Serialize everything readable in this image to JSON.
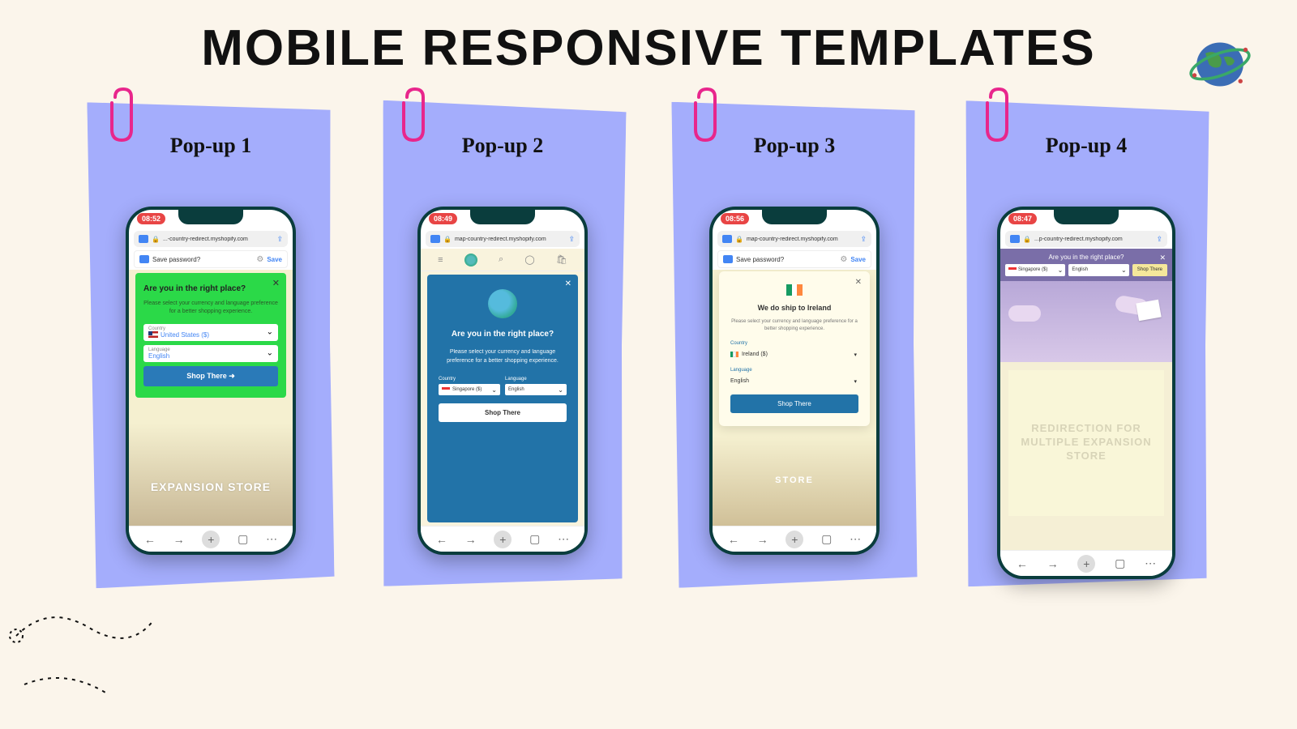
{
  "title": "MOBILE RESPONSIVE TEMPLATES",
  "cards": [
    {
      "title": "Pop-up 1"
    },
    {
      "title": "Pop-up 2"
    },
    {
      "title": "Pop-up 3"
    },
    {
      "title": "Pop-up 4"
    }
  ],
  "phone1": {
    "time": "08:52",
    "url": "...-country-redirect.myshopify.com",
    "save_prompt": "Save password?",
    "save_action": "Save",
    "popup": {
      "heading": "Are you in the right place?",
      "subtext": "Please select your currency and language preference for a better shopping experience.",
      "country_label": "Country",
      "country_value": "United States ($)",
      "language_label": "Language",
      "language_value": "English",
      "button": "Shop There  ➜"
    },
    "bg_text": "EXPANSION STORE"
  },
  "phone2": {
    "time": "08:49",
    "url": "map-country-redirect.myshopify.com",
    "popup": {
      "heading": "Are you in the right place?",
      "subtext": "Please select your currency and language preference for a better shopping experience.",
      "country_label": "Country",
      "country_value": "Singapore ($)",
      "language_label": "Language",
      "language_value": "English",
      "button": "Shop There"
    }
  },
  "phone3": {
    "time": "08:56",
    "url": "map-country-redirect.myshopify.com",
    "save_prompt": "Save password?",
    "save_action": "Save",
    "popup": {
      "heading": "We do ship to Ireland",
      "subtext": "Please select your currency and language preference for a better shopping experience.",
      "country_label": "Country",
      "country_value": "Ireland ($)",
      "language_label": "Language",
      "language_value": "English",
      "button": "Shop There"
    },
    "bg_text": "STORE"
  },
  "phone4": {
    "time": "08:47",
    "url": "...p-country-redirect.myshopify.com",
    "bar": {
      "question": "Are you in the right place?",
      "country_value": "Singapore ($)",
      "language_value": "English",
      "button": "Shop There"
    },
    "box_text": "REDIRECTION FOR MULTIPLE EXPANSION STORE"
  }
}
